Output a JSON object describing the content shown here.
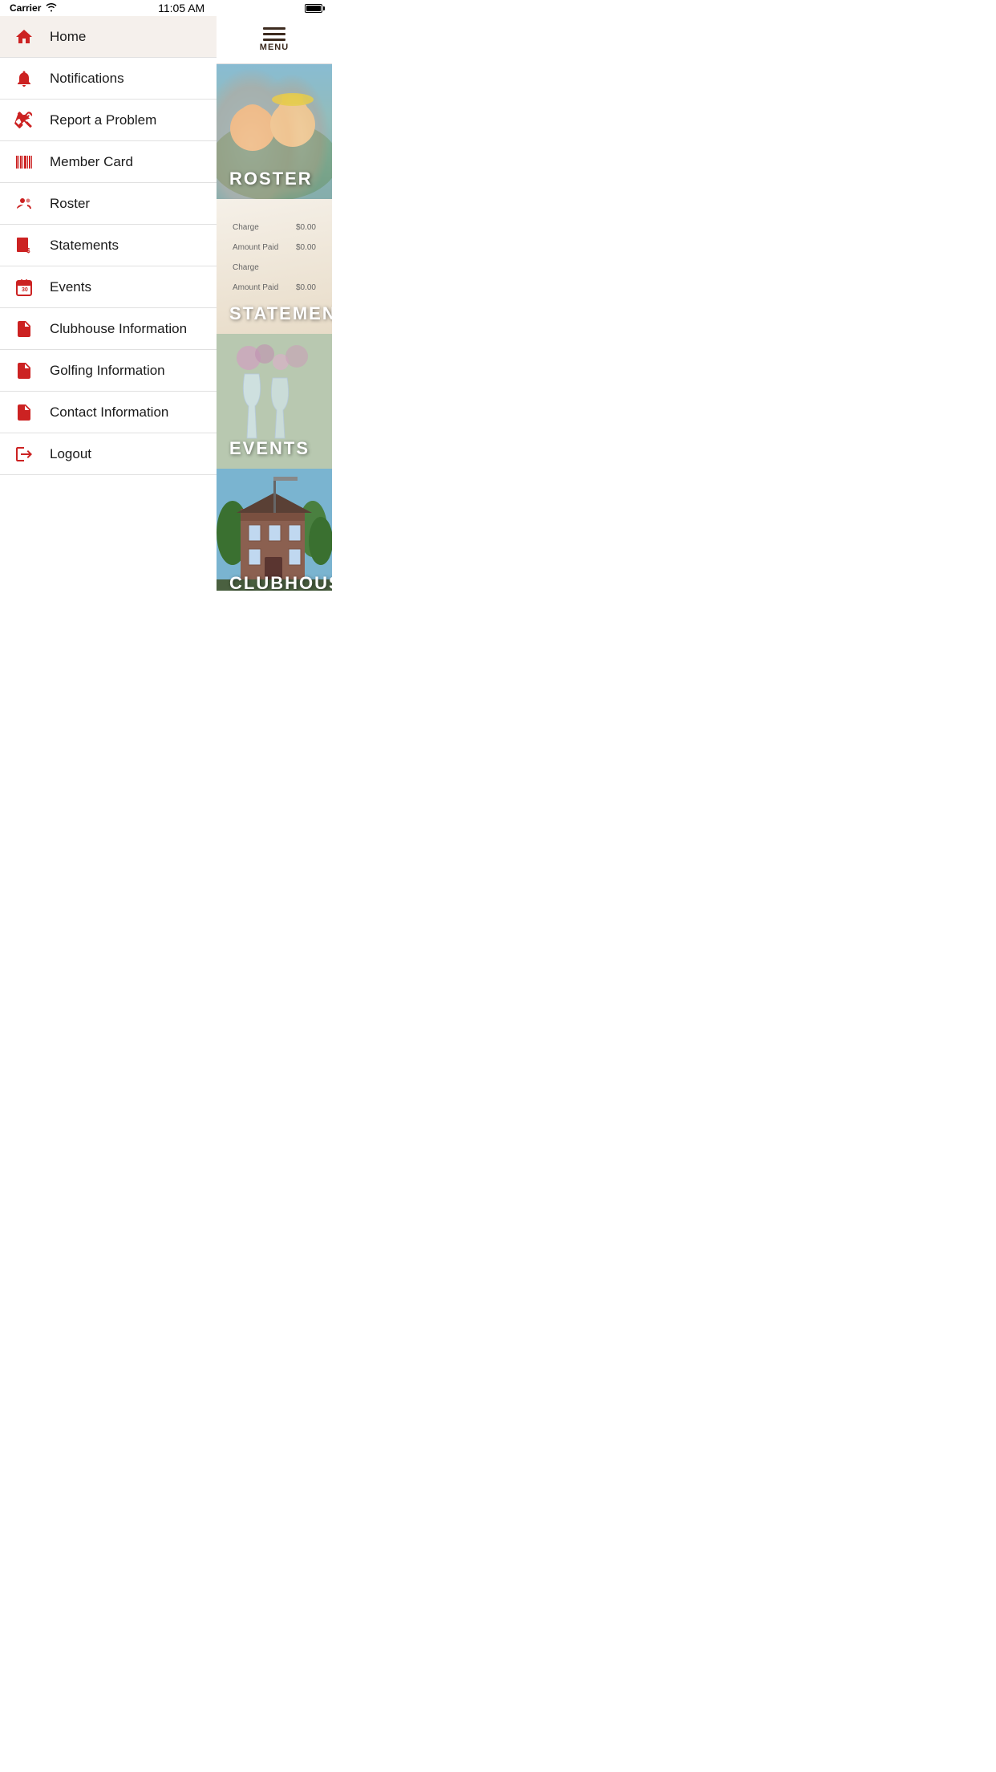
{
  "statusBar": {
    "carrier": "Carrier",
    "time": "11:05 AM"
  },
  "menuHeader": {
    "label": "MENU"
  },
  "sidebar": {
    "items": [
      {
        "id": "home",
        "label": "Home",
        "icon": "home",
        "active": true
      },
      {
        "id": "notifications",
        "label": "Notifications",
        "icon": "bell",
        "active": false
      },
      {
        "id": "report-problem",
        "label": "Report a Problem",
        "icon": "wrench",
        "active": false
      },
      {
        "id": "member-card",
        "label": "Member Card",
        "icon": "barcode",
        "active": false
      },
      {
        "id": "roster",
        "label": "Roster",
        "icon": "person",
        "active": false
      },
      {
        "id": "statements",
        "label": "Statements",
        "icon": "document-dollar",
        "active": false
      },
      {
        "id": "events",
        "label": "Events",
        "icon": "calendar",
        "active": false
      },
      {
        "id": "clubhouse-information",
        "label": "Clubhouse Information",
        "icon": "document",
        "active": false
      },
      {
        "id": "golfing-information",
        "label": "Golfing Information",
        "icon": "document",
        "active": false
      },
      {
        "id": "contact-information",
        "label": "Contact Information",
        "icon": "document",
        "active": false
      },
      {
        "id": "logout",
        "label": "Logout",
        "icon": "logout",
        "active": false
      }
    ]
  },
  "tiles": [
    {
      "id": "roster",
      "label": "ROSTER",
      "type": "roster"
    },
    {
      "id": "statements",
      "label": "STATEMENTS",
      "type": "statements"
    },
    {
      "id": "events",
      "label": "EVENTS",
      "type": "events"
    },
    {
      "id": "clubhouse",
      "label": "CLUBHOUSE",
      "type": "clubhouse"
    },
    {
      "id": "extra",
      "label": "",
      "type": "extra"
    }
  ],
  "statements": {
    "line1_label": "Charge",
    "line1_value": "$0.00",
    "line2_label": "Amount Paid",
    "line2_value": "$0.00",
    "line3_label": "Charge",
    "line3_value": "",
    "line4_label": "Amount Paid",
    "line4_value": "$0.00"
  }
}
